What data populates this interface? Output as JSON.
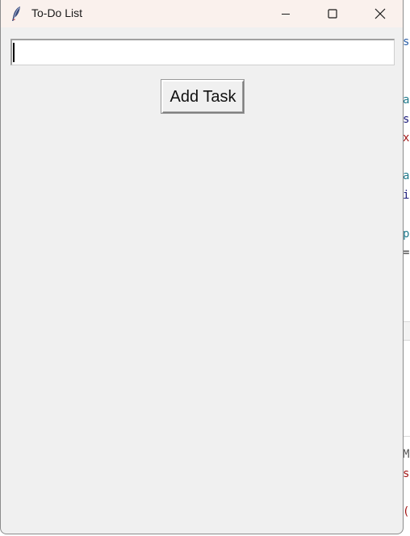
{
  "window": {
    "title": "To-Do List",
    "controls": {
      "minimize": "minimize",
      "maximize": "maximize",
      "close": "close"
    }
  },
  "entry": {
    "value": ""
  },
  "add_button": {
    "label": "Add Task"
  },
  "background_editor": {
    "glyphs": [
      "s",
      "a",
      "s",
      "x",
      "a",
      "i",
      "p",
      "=",
      "M",
      "s",
      "("
    ],
    "glyph_colors": [
      "#2a5fa8",
      "#1f7a8c",
      "#1a1a7a",
      "#a31515",
      "#1f7a8c",
      "#1a1a7a",
      "#1f7a8c",
      "#333333",
      "#555555",
      "#a31515",
      "#a31515"
    ]
  },
  "colors": {
    "titlebar": "#faf1ed",
    "window_bg": "#f0f0f0"
  }
}
